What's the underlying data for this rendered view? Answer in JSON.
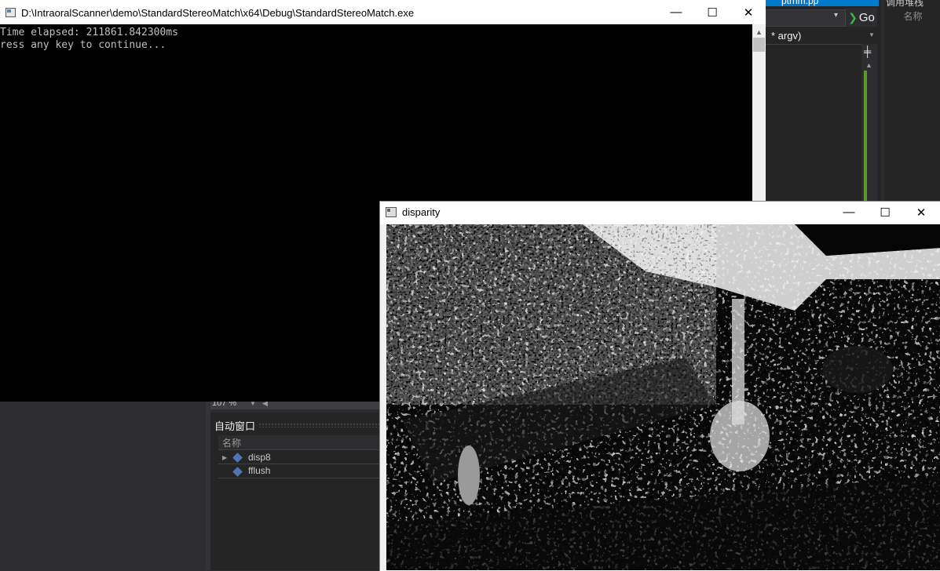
{
  "vs": {
    "tab_label": "ptrhm.pp",
    "tab_right_label": "调用堆栈",
    "name_column": "名称",
    "go_label": "Go",
    "member_dropdown": "* argv)",
    "zoom": "107 %",
    "autos": {
      "title": "自动窗口",
      "name_header": "名称",
      "rows": [
        {
          "name": "disp8",
          "expandable": true
        },
        {
          "name": "fflush",
          "expandable": false
        }
      ]
    }
  },
  "console": {
    "title": "D:\\IntraoralScanner\\demo\\StandardStereoMatch\\x64\\Debug\\StandardStereoMatch.exe",
    "lines": [
      "Time elapsed: 211861.842300ms",
      "ress any key to continue..."
    ],
    "minimize_glyph": "—",
    "maximize_glyph": "☐",
    "close_glyph": "✕"
  },
  "disparity": {
    "title": "disparity",
    "minimize_glyph": "—",
    "maximize_glyph": "☐",
    "close_glyph": "✕"
  },
  "colors": {
    "vs_background": "#2d2d30",
    "console_background": "#000000",
    "console_text": "#c0c0c0",
    "accent_blue": "#007acc",
    "go_green": "#3bb54a"
  }
}
